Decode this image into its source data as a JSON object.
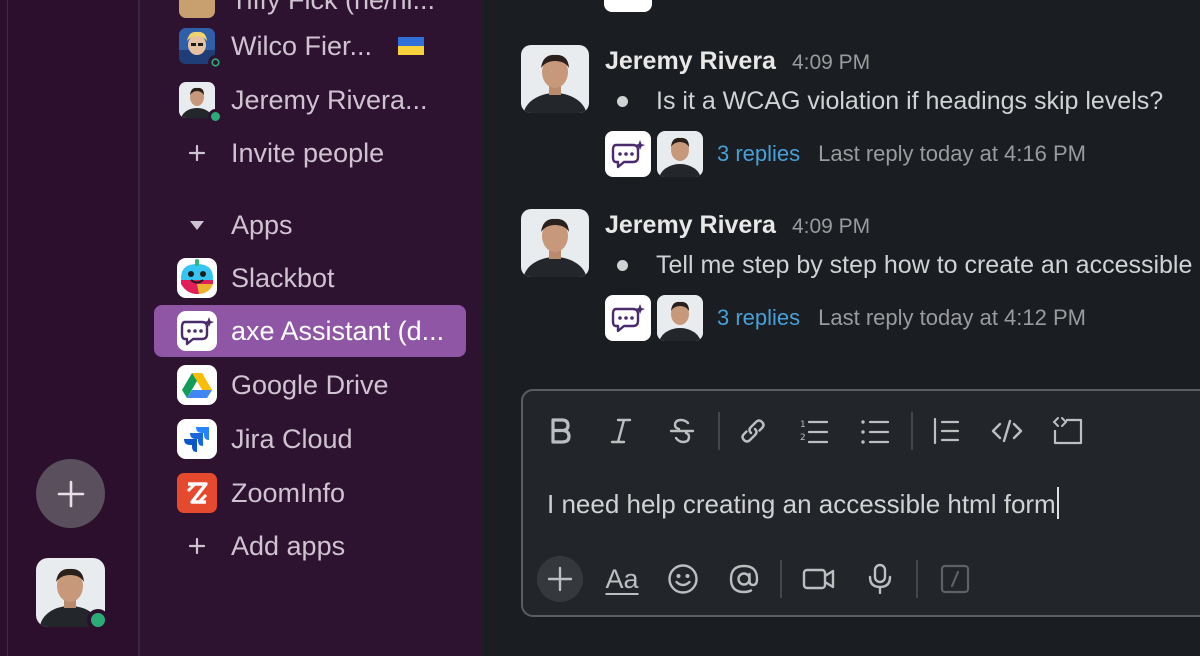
{
  "sidebar": {
    "top_partial_label": "Tiffy Fick (he/hi...",
    "items": [
      {
        "label": "Wilco Fier...",
        "icon": "user-avatar-icon",
        "status": "away"
      },
      {
        "label": "Jeremy Rivera...",
        "icon": "user-avatar-icon",
        "status": "online"
      },
      {
        "label": "Invite people",
        "icon": "plus-icon"
      },
      {
        "label": "Apps",
        "icon": "caret-down-icon"
      },
      {
        "label": "Slackbot",
        "icon": "slackbot-icon"
      },
      {
        "label": "axe Assistant (d...",
        "icon": "axe-assistant-icon",
        "active": true
      },
      {
        "label": "Google Drive",
        "icon": "google-drive-icon"
      },
      {
        "label": "Jira Cloud",
        "icon": "jira-icon"
      },
      {
        "label": "ZoomInfo",
        "icon": "zoominfo-icon"
      },
      {
        "label": "Add apps",
        "icon": "plus-icon"
      }
    ]
  },
  "messages": [
    {
      "author": "Jeremy Rivera",
      "time": "4:09 PM",
      "text": "Is it a WCAG violation if headings skip levels?",
      "replies": "3 replies",
      "last_reply": "Last reply today at 4:16 PM"
    },
    {
      "author": "Jeremy Rivera",
      "time": "4:09 PM",
      "text": "Tell me step by step how to create an accessible",
      "replies": "3 replies",
      "last_reply": "Last reply today at 4:12 PM"
    }
  ],
  "composer": {
    "text": "I need help creating an accessible html form",
    "format_buttons": [
      "bold",
      "italic",
      "strikethrough",
      "link",
      "ordered-list",
      "bulleted-list",
      "blockquote",
      "code",
      "code-block"
    ],
    "aa_label": "Aa"
  },
  "colors": {
    "rail_bg": "#2b0f2d",
    "sidebar_bg": "#2d1330",
    "active_item": "#8e56a5",
    "main_bg": "#1a1d21",
    "link": "#48a0d8",
    "online": "#2bac76"
  }
}
